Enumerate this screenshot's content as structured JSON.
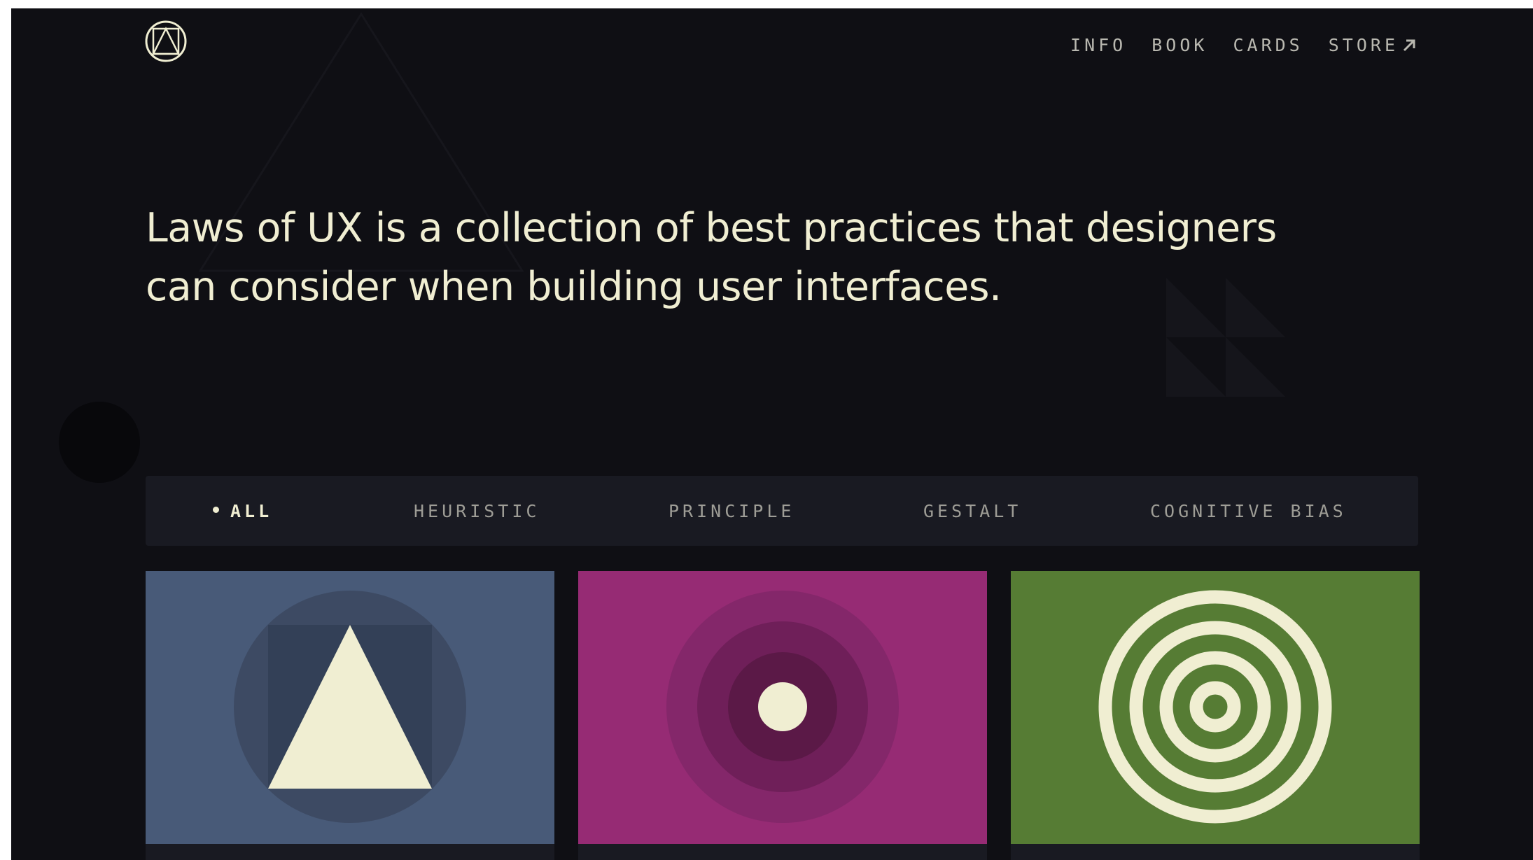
{
  "header": {
    "logo_icon": "laws-of-ux-logo-icon",
    "nav": [
      {
        "label": "INFO"
      },
      {
        "label": "BOOK"
      },
      {
        "label": "CARDS"
      },
      {
        "label": "STORE",
        "icon": "arrow-up-right-icon"
      }
    ]
  },
  "hero": {
    "line1": "Laws of UX is a collection of best practices that designers",
    "line2": "can consider when building user interfaces."
  },
  "filters": {
    "items": [
      {
        "label": "ALL",
        "active": true
      },
      {
        "label": "HEURISTIC",
        "active": false
      },
      {
        "label": "PRINCIPLE",
        "active": false
      },
      {
        "label": "GESTALT",
        "active": false
      },
      {
        "label": "COGNITIVE BIAS",
        "active": false
      }
    ]
  },
  "cards": [
    {
      "icon": "triangle-in-circle-icon",
      "color": "#485a78"
    },
    {
      "icon": "concentric-circles-dot-icon",
      "color": "#962b74"
    },
    {
      "icon": "target-rings-icon",
      "color": "#567c34"
    }
  ],
  "colors": {
    "background": "#0f0f14",
    "text": "#f0eed2",
    "nav_text": "#b9b8b0",
    "filter_bar": "#191a22"
  }
}
